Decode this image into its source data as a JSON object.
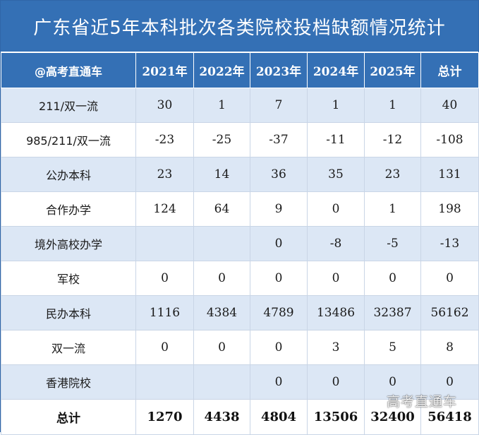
{
  "title": "广东省近5年本科批次各类院校投档缺额情况统计",
  "watermark": "高考直通车",
  "colors": {
    "header_bg": "#3470b5",
    "row_shade": "#dce7f5",
    "header_text": "#ffffff"
  },
  "table": {
    "columns": [
      "@高考直通车",
      "2021年",
      "2022年",
      "2023年",
      "2024年",
      "2025年",
      "总计"
    ],
    "rows": [
      {
        "label": "211/双一流",
        "values": [
          "30",
          "1",
          "7",
          "1",
          "1",
          "40"
        ]
      },
      {
        "label": "985/211/双一流",
        "values": [
          "-23",
          "-25",
          "-37",
          "-11",
          "-12",
          "-108"
        ]
      },
      {
        "label": "公办本科",
        "values": [
          "23",
          "14",
          "36",
          "35",
          "23",
          "131"
        ]
      },
      {
        "label": "合作办学",
        "values": [
          "124",
          "64",
          "9",
          "0",
          "1",
          "198"
        ]
      },
      {
        "label": "境外高校办学",
        "values": [
          "",
          "",
          "0",
          "-8",
          "-5",
          "-13"
        ]
      },
      {
        "label": "军校",
        "values": [
          "0",
          "0",
          "0",
          "0",
          "0",
          "0"
        ]
      },
      {
        "label": "民办本科",
        "values": [
          "1116",
          "4384",
          "4789",
          "13486",
          "32387",
          "56162"
        ]
      },
      {
        "label": "双一流",
        "values": [
          "0",
          "0",
          "0",
          "3",
          "5",
          "8"
        ]
      },
      {
        "label": "香港院校",
        "values": [
          "",
          "",
          "0",
          "0",
          "0",
          "0"
        ]
      }
    ],
    "total": {
      "label": "总计",
      "values": [
        "1270",
        "4438",
        "4804",
        "13506",
        "32400",
        "56418"
      ]
    }
  }
}
